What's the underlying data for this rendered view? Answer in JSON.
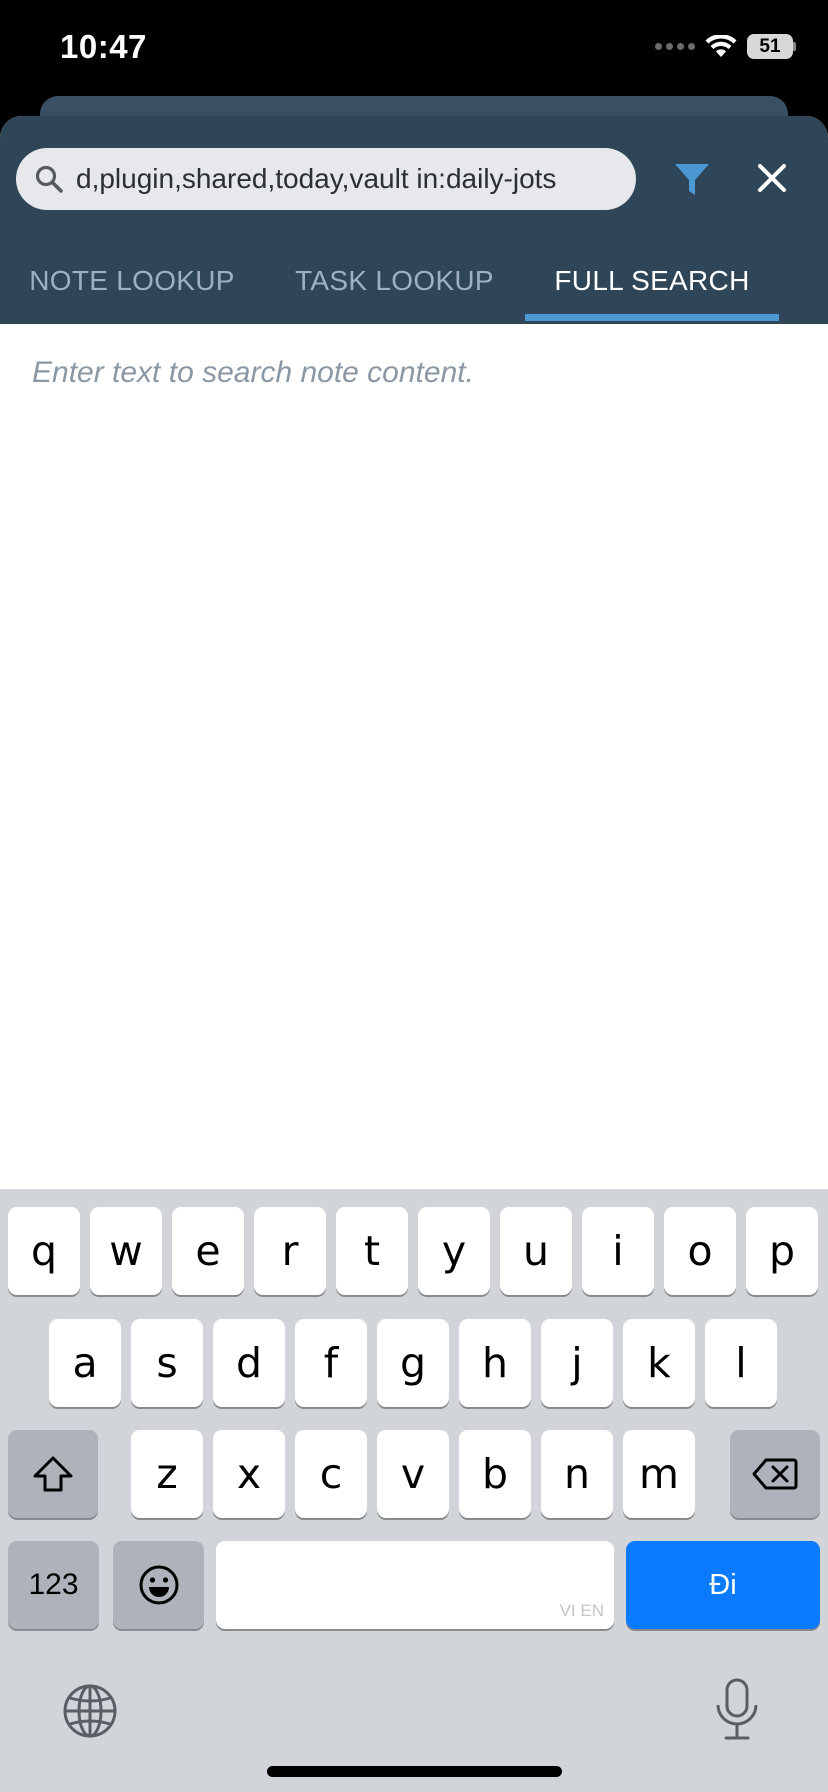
{
  "status_bar": {
    "time": "10:47",
    "battery": "51"
  },
  "search": {
    "query": "d,plugin,shared,today,vault in:daily-jots"
  },
  "tabs": [
    {
      "label": "NOTE LOOKUP",
      "active": false
    },
    {
      "label": "TASK LOOKUP",
      "active": false
    },
    {
      "label": "FULL SEARCH",
      "active": true
    }
  ],
  "content": {
    "placeholder": "Enter text to search note content."
  },
  "keyboard": {
    "row1": [
      "q",
      "w",
      "e",
      "r",
      "t",
      "y",
      "u",
      "i",
      "o",
      "p"
    ],
    "row2": [
      "a",
      "s",
      "d",
      "f",
      "g",
      "h",
      "j",
      "k",
      "l"
    ],
    "row3": [
      "z",
      "x",
      "c",
      "v",
      "b",
      "n",
      "m"
    ],
    "numbers_label": "123",
    "return_label": "Đi",
    "space_hint": "VI EN"
  },
  "colors": {
    "header": "#2f4658",
    "accent": "#4c98d3",
    "return_key": "#0a7aff"
  }
}
